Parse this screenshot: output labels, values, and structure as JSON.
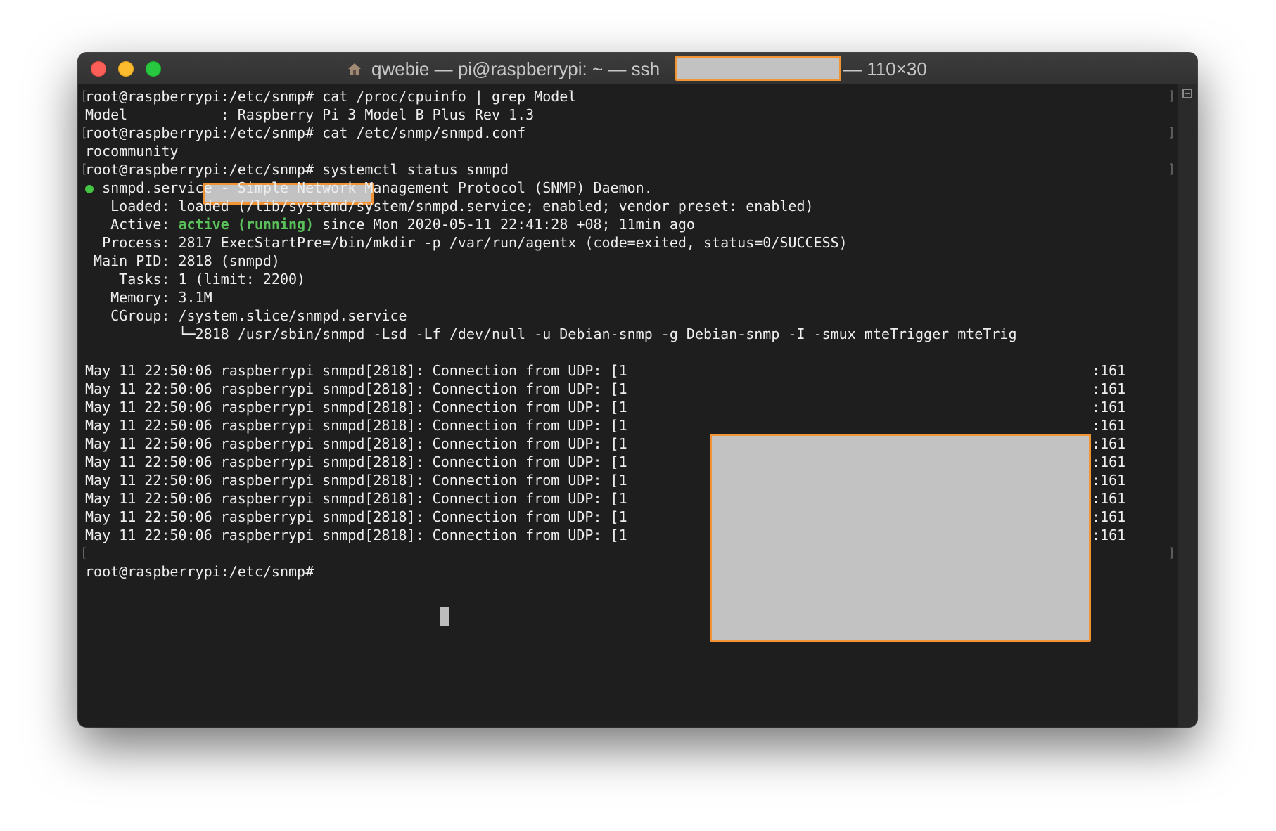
{
  "window": {
    "title_before": "qwebie — pi@raspberrypi: ~ — ssh",
    "title_after": "— 110×30",
    "title_icon": "home-folder-icon"
  },
  "terminal": {
    "lines": [
      "root@raspberrypi:/etc/snmp# cat /proc/cpuinfo | grep Model",
      "Model           : Raspberry Pi 3 Model B Plus Rev 1.3",
      "root@raspberrypi:/etc/snmp# cat /etc/snmp/snmpd.conf",
      "rocommunity",
      "root@raspberrypi:/etc/snmp# systemctl status snmpd",
      " snmpd.service - Simple Network Management Protocol (SNMP) Daemon.",
      "   Loaded: loaded (/lib/systemd/system/snmpd.service; enabled; vendor preset: enabled)",
      "   Active:",
      "active (running)",
      " since Mon 2020-05-11 22:41:28 +08; 11min ago",
      "  Process: 2817 ExecStartPre=/bin/mkdir -p /var/run/agentx (code=exited, status=0/SUCCESS)",
      " Main PID: 2818 (snmpd)",
      "    Tasks: 1 (limit: 2200)",
      "   Memory: 3.1M",
      "   CGroup: /system.slice/snmpd.service",
      "           └─2818 /usr/sbin/snmpd -Lsd -Lf /dev/null -u Debian-snmp -g Debian-snmp -I -smux mteTrigger mteTrig",
      "root@raspberrypi:/etc/snmp# "
    ],
    "status_dot": "●",
    "log_prefix": "May 11 22:50:06 raspberrypi snmpd[2818]: Connection from UDP: [1",
    "log_suffix": ":161",
    "log_lines": [
      {
        "prefix": "May 11 22:50:06 raspberrypi snmpd[2818]: Connection from UDP: [1",
        "suffix": ":161"
      },
      {
        "prefix": "May 11 22:50:06 raspberrypi snmpd[2818]: Connection from UDP: [1",
        "suffix": ":161"
      },
      {
        "prefix": "May 11 22:50:06 raspberrypi snmpd[2818]: Connection from UDP: [1",
        "suffix": ":161"
      },
      {
        "prefix": "May 11 22:50:06 raspberrypi snmpd[2818]: Connection from UDP: [1",
        "suffix": ":161"
      },
      {
        "prefix": "May 11 22:50:06 raspberrypi snmpd[2818]: Connection from UDP: [1",
        "suffix": ":161"
      },
      {
        "prefix": "May 11 22:50:06 raspberrypi snmpd[2818]: Connection from UDP: [1",
        "suffix": ":161"
      },
      {
        "prefix": "May 11 22:50:06 raspberrypi snmpd[2818]: Connection from UDP: [1",
        "suffix": ":161"
      },
      {
        "prefix": "May 11 22:50:06 raspberrypi snmpd[2818]: Connection from UDP: [1",
        "suffix": ":161"
      },
      {
        "prefix": "May 11 22:50:06 raspberrypi snmpd[2818]: Connection from UDP: [1",
        "suffix": ":161"
      },
      {
        "prefix": "May 11 22:50:06 raspberrypi snmpd[2818]: Connection from UDP: [1",
        "suffix": ":161"
      }
    ],
    "mark_left": "[",
    "mark_right": "]"
  },
  "colors": {
    "terminal_bg": "#1e1e1e",
    "text": "#eeeeee",
    "active_green": "#5ac05a",
    "redaction_fill": "#c2c2c2",
    "redaction_border": "#f29335"
  },
  "icons": {
    "close": "close-icon",
    "minimize": "minimize-icon",
    "zoom": "zoom-icon",
    "scroll": "scroll-toggle-icon"
  }
}
